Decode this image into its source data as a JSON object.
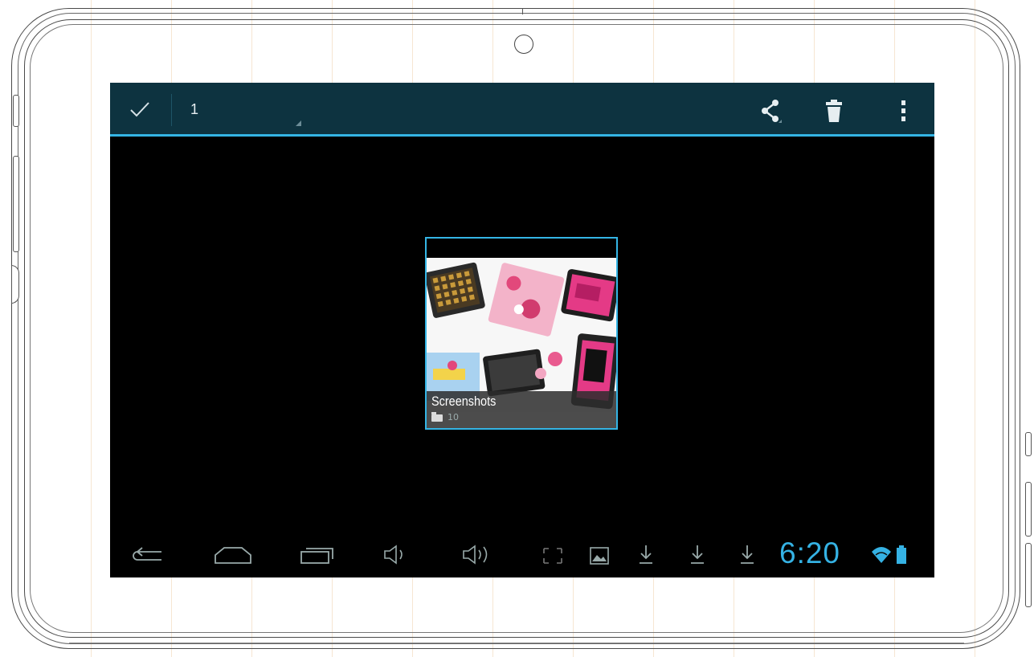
{
  "action_bar": {
    "selected_count": "1",
    "icons": [
      "check-icon",
      "share-icon",
      "trash-icon",
      "overflow-menu-icon"
    ]
  },
  "album": {
    "name": "Screenshots",
    "count": "10"
  },
  "status": {
    "time": "6:20"
  },
  "colors": {
    "accent": "#34b5e5",
    "action_bar_bg": "#0d3340",
    "screen_bg": "#000000",
    "clock": "#35b2e4"
  }
}
